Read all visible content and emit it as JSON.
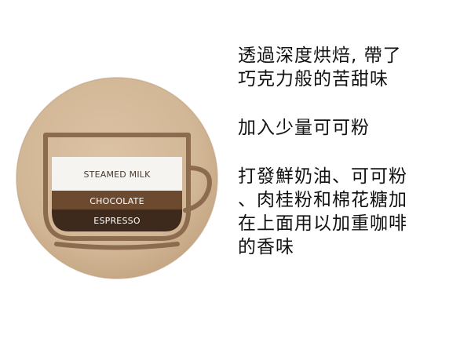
{
  "illustration": {
    "layers": [
      {
        "label": "STEAMED MILK",
        "color": "#f6f4f1",
        "text_color": "#4a3a2c"
      },
      {
        "label": "CHOCOLATE",
        "color": "#6b4a2f",
        "text_color": "#ffffff"
      },
      {
        "label": "ESPRESSO",
        "color": "#3d2a1c",
        "text_color": "#ffffff"
      }
    ],
    "disc_color": "#d2b796",
    "outline_color": "#8c6b4f"
  },
  "description": {
    "paragraphs": [
      "透過深度烘焙, 帶了\n巧克力般的苦甜味",
      "加入少量可可粉",
      "打發鮮奶油、可可粉\n、肉桂粉和棉花糖加\n在上面用以加重咖啡\n的香味"
    ]
  }
}
